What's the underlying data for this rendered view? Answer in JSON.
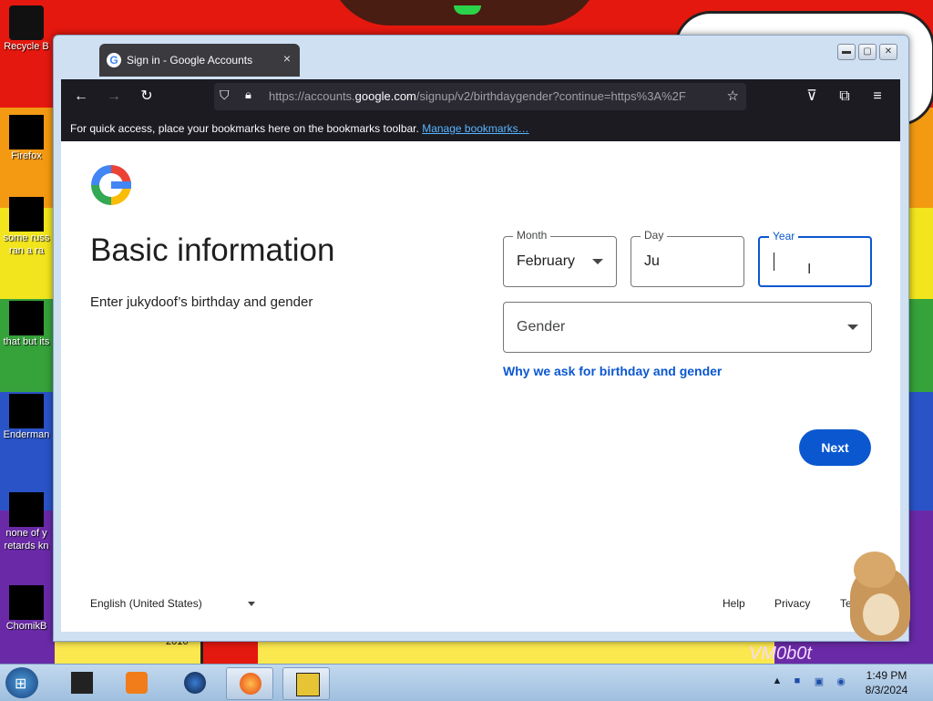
{
  "desktop": {
    "wallpaper_caption_2016": "2016",
    "wallpaper_caption_vm": "VM0b0t",
    "icons": [
      {
        "label": "Recycle Bin",
        "short": "Recycle B"
      },
      {
        "label": "Firefox"
      },
      {
        "label": "some russ ran a ra",
        "line1": "some russ",
        "line2": "ran a ra"
      },
      {
        "label": "that but its"
      },
      {
        "label": "Enderman"
      },
      {
        "label": "none of y retards kn",
        "line1": "none of y",
        "line2": "retards kn"
      },
      {
        "label": "ChomikB"
      }
    ]
  },
  "browser": {
    "tab_title": "Sign in - Google Accounts",
    "tab_close": "×",
    "window_buttons": {
      "minimize": "▬",
      "maximize": "▢",
      "close": "✕"
    },
    "url": {
      "prefix": "https://accounts.",
      "domain": "google.com",
      "path": "/signup/v2/birthdaygender?continue=https%3A%2F"
    },
    "bookmarks_text": "For quick access, place your bookmarks here on the bookmarks toolbar.",
    "bookmarks_link": "Manage bookmarks…"
  },
  "page": {
    "title": "Basic information",
    "subtitle": "Enter jukydoof’s birthday and gender",
    "month": {
      "label": "Month",
      "value": "February"
    },
    "day": {
      "label": "Day",
      "value": "Ju"
    },
    "year": {
      "label": "Year",
      "value": ""
    },
    "gender": {
      "placeholder": "Gender"
    },
    "why_link": "Why we ask for birthday and gender",
    "next_button": "Next",
    "footer": {
      "language": "English (United States)",
      "help": "Help",
      "privacy": "Privacy",
      "terms": "Terms"
    }
  },
  "taskbar": {
    "time": "1:49 PM",
    "date": "8/3/2024"
  },
  "colors": {
    "google_blue": "#0b57d0",
    "firefox_toolbar": "#1c1b22",
    "taskbar": "#9fbfdf"
  }
}
